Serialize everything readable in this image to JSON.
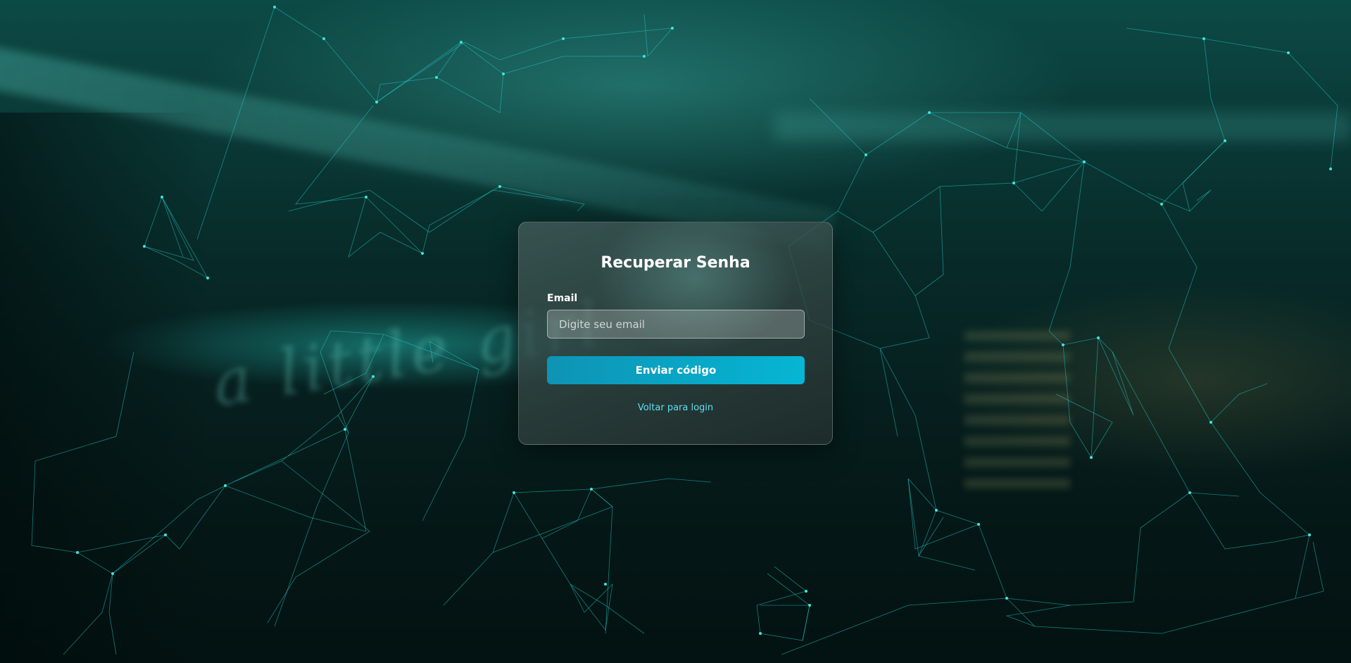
{
  "page": {
    "title": "Recuperar Senha"
  },
  "form": {
    "email_label": "Email",
    "email_placeholder": "Digite seu email",
    "email_value": "",
    "submit_label": "Enviar código",
    "back_link_label": "Voltar para login"
  },
  "background": {
    "sign_text": "a little girl",
    "accent_color": "#06b6d4",
    "network_line_color": "#22d3d3"
  }
}
